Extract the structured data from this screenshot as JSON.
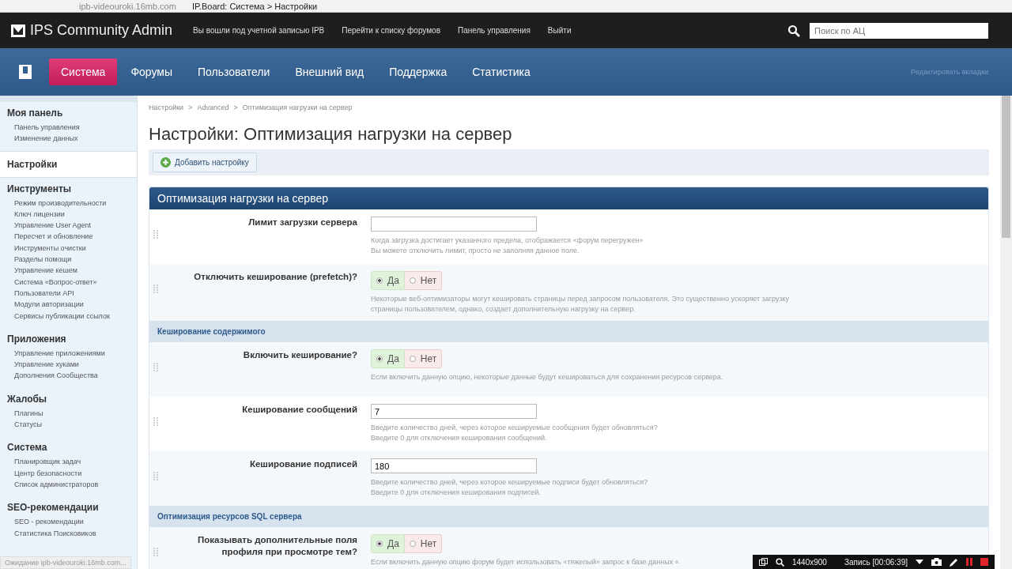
{
  "browser": {
    "address": "ipb-videouroki.16mb.com",
    "page_title": "IP.Board: Система > Настройки",
    "status": "Ожидание ipb-videouroki.16mb.com..."
  },
  "topbar": {
    "brand": "IPS Community Admin",
    "links": [
      "Вы вошли под учетной записью IPB",
      "Перейти к списку форумов",
      "Панель управления",
      "Выйти"
    ],
    "search_placeholder": "Поиск по АЦ"
  },
  "tabs": [
    {
      "label": "Система",
      "selected": true
    },
    {
      "label": "Форумы",
      "selected": false
    },
    {
      "label": "Пользователи",
      "selected": false
    },
    {
      "label": "Внешний вид",
      "selected": false
    },
    {
      "label": "Поддержка",
      "selected": false
    },
    {
      "label": "Статистика",
      "selected": false
    }
  ],
  "edit_tabs": "Редактировать вкладки",
  "sidebar": [
    {
      "title": "Моя панель",
      "selected": false,
      "items": [
        "Панель управления",
        "Изменение данных"
      ]
    },
    {
      "title": "Настройки",
      "selected": true
    },
    {
      "title": "Инструменты",
      "selected": false,
      "items": [
        "Режим производительности",
        "Ключ лицензии",
        "Управление User Agent",
        "Пересчет и обновление",
        "Инструменты очистки",
        "Разделы помощи",
        "Управление кешем",
        "Система «Вопрос-ответ»",
        "Пользователи API",
        "Модули авторизации",
        "Сервисы публикации ссылок"
      ]
    },
    {
      "title": "Приложения",
      "selected": false,
      "items": [
        "Управление приложениями",
        "Управление хуками",
        "Дополнения Сообщества"
      ]
    },
    {
      "title": "Жалобы",
      "selected": false,
      "items": [
        "Плагины",
        "Статусы"
      ]
    },
    {
      "title": "Система",
      "selected": false,
      "items": [
        "Планировщик задач",
        "Центр безопасности",
        "Список администраторов"
      ]
    },
    {
      "title": "SEO-рекомендации",
      "selected": false,
      "items": [
        "SEO - рекомендации",
        "Статистика Поисковиков"
      ]
    }
  ],
  "breadcrumb": [
    {
      "label": "Настройки"
    },
    {
      "separator": ">",
      "label": "Advanced"
    },
    {
      "separator": ">",
      "label": "Оптимизация нагрузки на сервер"
    }
  ],
  "page_title": "Настройки: Оптимизация нагрузки на сервер",
  "add_button": "Добавить настройку",
  "panel_title": "Оптимизация нагрузки на сервер",
  "rows": [
    {
      "kind": "text",
      "label": "Лимит загрузки сервера",
      "value": "",
      "help": [
        "Когда загрузка достигает указанного предела, отображается «форум перегружен»",
        "Вы можете отключить лимит, просто не заполняя данное поле."
      ]
    },
    {
      "kind": "yesno",
      "label": "Отключить кеширование (prefetch)?",
      "yes": "Да",
      "no": "Нет",
      "on": true,
      "help": [
        "Некоторые веб-оптимизаторы могут кешировать страницы перед запросом пользователя. Это существенно ускоряет загрузку",
        "страницы пользователем, однако, создает дополнительную нагрузку на сервер."
      ]
    },
    {
      "kind": "section",
      "label": "Кеширование содержимого"
    },
    {
      "kind": "yesno",
      "label": "Включить кеширование?",
      "yes": "Да",
      "no": "Нет",
      "on": true,
      "help": [
        "Если включить данную опцию, некоторые данные будут кешироваться для сохранения ресурсов сервера."
      ]
    },
    {
      "kind": "text",
      "label": "Кеширование сообщений",
      "value": "7",
      "help": [
        "Введите количество дней, через которое кешируемые сообщения будет обновляться?",
        "Введите 0 для отключения кеширования сообщений."
      ]
    },
    {
      "kind": "text",
      "label": "Кеширование подписей",
      "value": "180",
      "help": [
        "Введите количество дней, через которое кешируемые подписи будет обновляться?",
        "Введите 0 для отключения кеширования подписей."
      ]
    },
    {
      "kind": "section",
      "label": "Оптимизация ресурсов SQL сервера"
    },
    {
      "kind": "yesno",
      "label": "Показывать дополнительные поля профиля при просмотре тем?",
      "yes": "Да",
      "no": "Нет",
      "on": true,
      "help": [
        "Если включить данную опцию форум будет использовать «тяжелый» запрос к базе данных «"
      ]
    }
  ],
  "recorder": {
    "resolution": "1440x900",
    "status": "Запись [00:06:39]"
  }
}
